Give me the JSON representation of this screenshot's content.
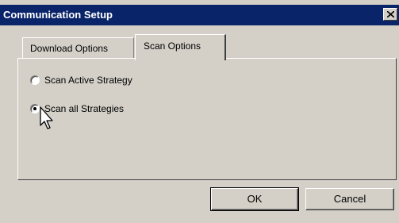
{
  "window": {
    "title": "Communication Setup",
    "close_glyph": "×"
  },
  "tabs": [
    {
      "label": "Download Options",
      "selected": false
    },
    {
      "label": "Scan Options",
      "selected": true
    }
  ],
  "scan_options": {
    "options": [
      {
        "label": "Scan Active Strategy",
        "checked": false
      },
      {
        "label": "Scan all Strategies",
        "checked": true
      }
    ]
  },
  "buttons": {
    "ok_label": "OK",
    "cancel_label": "Cancel"
  },
  "colors": {
    "titlebar": "#0a246a",
    "face": "#d4d0c8"
  }
}
